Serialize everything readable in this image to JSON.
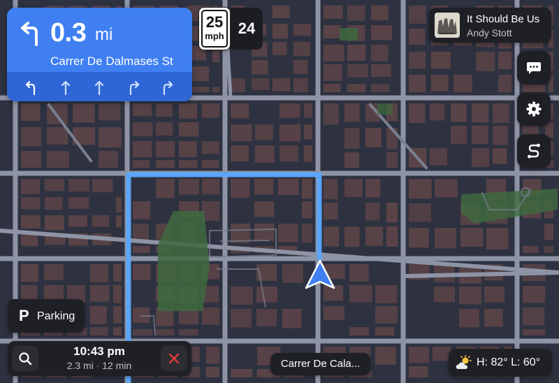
{
  "navigation": {
    "distance": "0.3",
    "unit": "mi",
    "street": "Carrer De Dalmases St",
    "maneuver_icon": "turn-left-icon",
    "lanes": [
      "turn-left",
      "straight",
      "straight",
      "turn-right",
      "turn-right"
    ]
  },
  "speed": {
    "limit": "25",
    "limit_unit": "mph",
    "current": "24"
  },
  "now_playing": {
    "title": "It Should Be Us",
    "artist": "Andy Stott"
  },
  "side_buttons": [
    "message-icon",
    "gear-icon",
    "route-icon"
  ],
  "parking": {
    "icon": "P",
    "label": "Parking"
  },
  "trip": {
    "eta": "10:43 pm",
    "summary": "2.3 mi · 12 min"
  },
  "current_street": "Carrer De Cala...",
  "weather": {
    "icon": "partly-cloudy-icon",
    "text": "H: 82°  L: 60°"
  },
  "colors": {
    "nav_card": "#3f7ff2",
    "route": "#5aa7ff",
    "buildings": "#5a4347",
    "map_background": "#2e3240",
    "park": "#3f6a3f",
    "position_marker": "#3f7ff2",
    "cancel": "#e03a3a"
  }
}
